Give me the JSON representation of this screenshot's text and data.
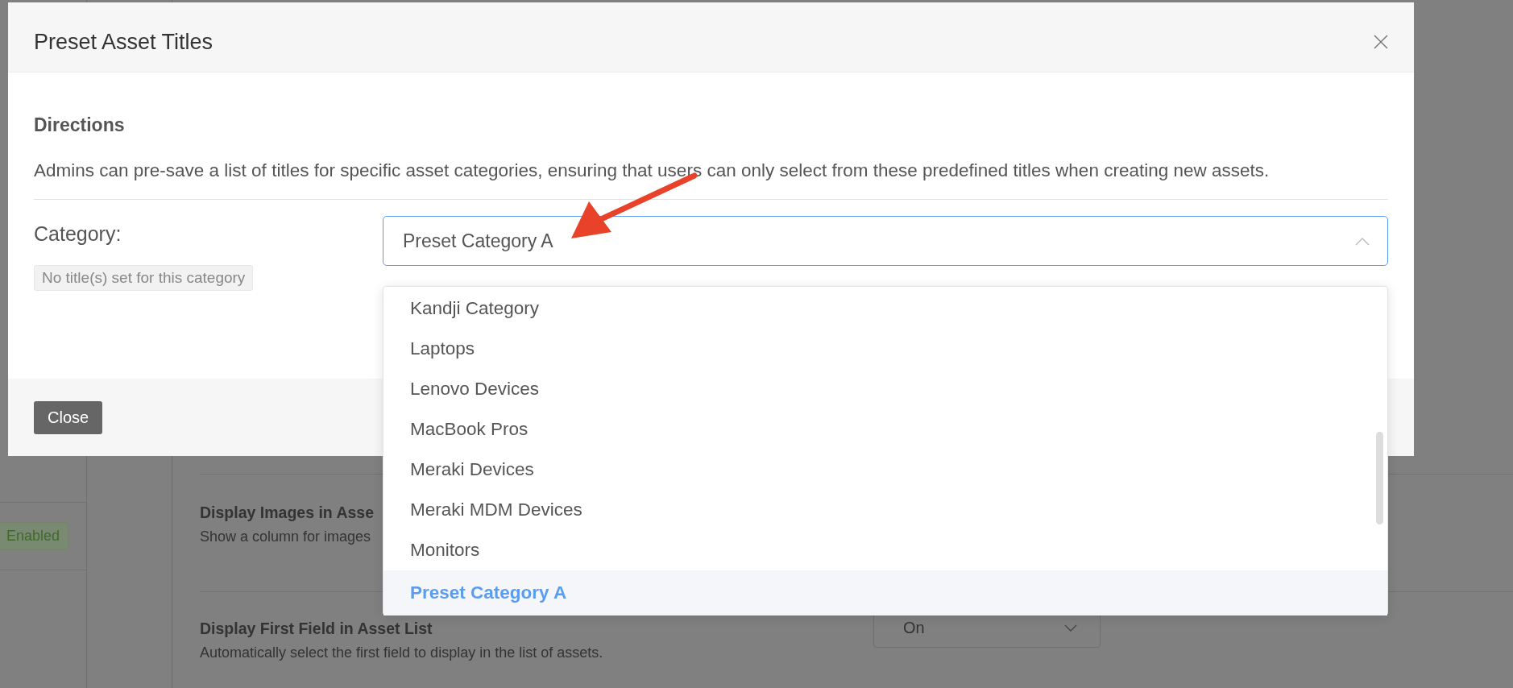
{
  "background": {
    "status_badge": "Enabled",
    "settings": [
      {
        "title": "Display Images in Asse",
        "description": "Show a column for images"
      },
      {
        "title": "Display First Field in Asset List",
        "description": "Automatically select the first field to display in the list of assets.",
        "select": "On"
      }
    ]
  },
  "dialog": {
    "title": "Preset Asset Titles",
    "section_heading": "Directions",
    "description": "Admins can pre-save a list of titles for specific asset categories, ensuring that users can only select from these predefined titles when creating new assets.",
    "category_label": "Category:",
    "empty_badge": "No title(s) set for this category",
    "category_select": {
      "value": "Preset Category A",
      "expanded": true
    },
    "options": [
      {
        "label": "Kandji Category",
        "selected": false
      },
      {
        "label": "Laptops",
        "selected": false
      },
      {
        "label": "Lenovo Devices",
        "selected": false
      },
      {
        "label": "MacBook Pros",
        "selected": false
      },
      {
        "label": "Meraki Devices",
        "selected": false
      },
      {
        "label": "Meraki MDM Devices",
        "selected": false
      },
      {
        "label": "Monitors",
        "selected": false
      },
      {
        "label": "Preset Category A",
        "selected": true
      }
    ],
    "close_button": "Close"
  }
}
